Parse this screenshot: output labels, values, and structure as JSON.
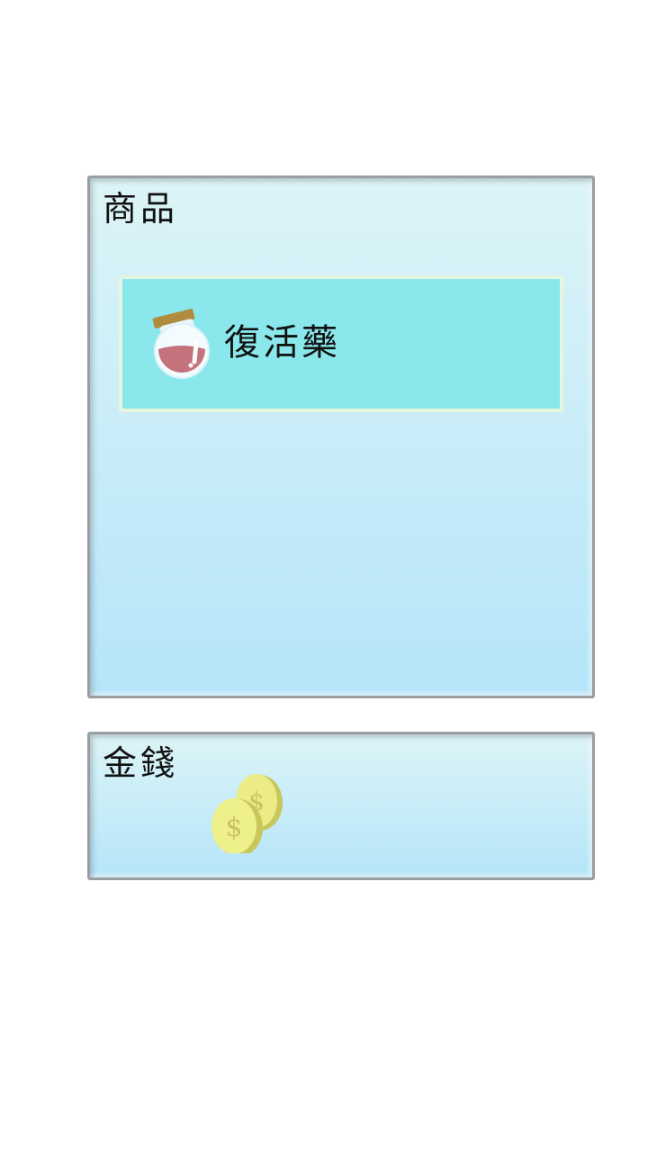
{
  "items_panel": {
    "title": "商品",
    "items": [
      {
        "name": "復活藥",
        "icon": "potion-jar-icon"
      }
    ]
  },
  "money_panel": {
    "title": "金錢",
    "icon": "gold-coins-icon"
  },
  "colors": {
    "panel_top": "#dcf4f7",
    "panel_bottom": "#b5e5f9",
    "panel_border": "#9a9ea3",
    "item_slot": "#8ae8ec",
    "potion_liquid": "#c4737c",
    "coin": "#e6e87a"
  }
}
